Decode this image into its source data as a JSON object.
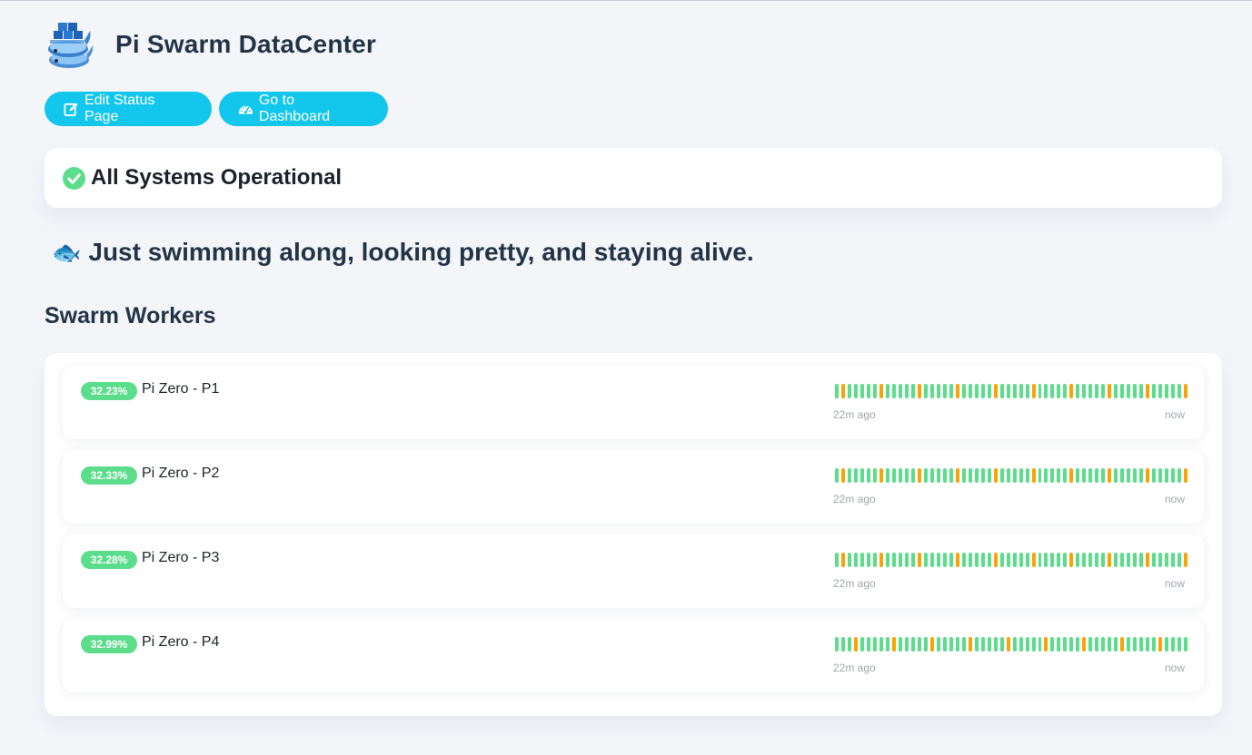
{
  "header": {
    "title": "Pi Swarm DataCenter",
    "logo_icon": "docker-whale-swarm-logo"
  },
  "actions": {
    "edit_label": "Edit Status Page",
    "edit_icon": "edit-icon",
    "dashboard_label": "Go to Dashboard",
    "dashboard_icon": "tachometer-icon"
  },
  "overall": {
    "text": "All Systems Operational",
    "icon": "check-circle-icon",
    "color": "#5cdd8b"
  },
  "description": {
    "emoji": "🐟",
    "text": "Just swimming along, looking pretty, and staying alive."
  },
  "group": {
    "title": "Swarm Workers",
    "monitors": [
      {
        "uptime": "32.23%",
        "name": "Pi Zero - P1",
        "from": "22m ago",
        "to": "now",
        "beats": "gwgggggwgggggwgggggwgggggwgggggwgggggwgggggwgggggwgggggw"
      },
      {
        "uptime": "32.33%",
        "name": "Pi Zero - P2",
        "from": "22m ago",
        "to": "now",
        "beats": "gwgggggwgggggwgggggwgggggwgggggwgggggwgggggwgggggwgggggw"
      },
      {
        "uptime": "32.28%",
        "name": "Pi Zero - P3",
        "from": "22m ago",
        "to": "now",
        "beats": "gwgggggwgggggwgggggwgggggwgggggwgggggwgggggwgggggwgggggw"
      },
      {
        "uptime": "32.99%",
        "name": "Pi Zero - P4",
        "from": "22m ago",
        "to": "now",
        "beats": "gggwgggggwgggggwgggggwgggggwgggggwgggggwgggggwgggggwgggg"
      }
    ]
  },
  "colors": {
    "up": "#5cdd8b",
    "pending": "#f8a306",
    "accent": "#13c6ec"
  }
}
